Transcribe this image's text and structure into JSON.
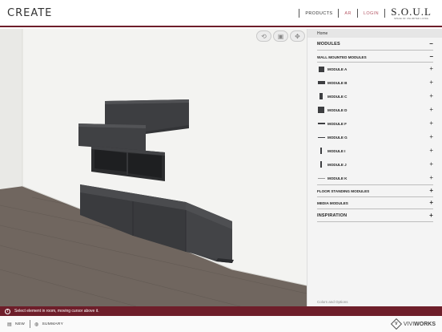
{
  "header": {
    "title": "CREATE",
    "nav": [
      {
        "label": "PRODUCTS",
        "accent": false
      },
      {
        "label": "AR",
        "accent": true
      },
      {
        "label": "LOGIN",
        "accent": true
      }
    ],
    "brand_logo": "S.O.U.L",
    "brand_tagline": "SPACE OF UNLIMITED LIVING"
  },
  "viewport": {
    "tools": [
      {
        "icon": "rotate-icon",
        "glyph": "⟲"
      },
      {
        "icon": "camera-icon",
        "glyph": "▣"
      },
      {
        "icon": "move-icon",
        "glyph": "✥"
      }
    ]
  },
  "panel": {
    "breadcrumb": "Home",
    "modules_heading": "MODULES",
    "modules_toggle": "−",
    "wall_heading": "WALL MOUNTED MODULES",
    "wall_toggle": "−",
    "modules": [
      {
        "label": "MODULE A",
        "icon": "square"
      },
      {
        "label": "MODULE B",
        "icon": "wide"
      },
      {
        "label": "MODULE C",
        "icon": "tall"
      },
      {
        "label": "MODULE D",
        "icon": "square"
      },
      {
        "label": "MODULE F",
        "icon": "flat"
      },
      {
        "label": "MODULE G",
        "icon": "thin"
      },
      {
        "label": "MODULE I",
        "icon": "vline"
      },
      {
        "label": "MODULE J",
        "icon": "vline"
      },
      {
        "label": "MODULE K",
        "icon": "hline"
      }
    ],
    "floor_heading": "FLOOR STANDING MODULES",
    "media_heading": "MEDIA MODULES",
    "inspiration_heading": "INSPIRATION",
    "plus": "+",
    "footer": "Colors and Options"
  },
  "status": {
    "icon": "!",
    "message": "Select element in room, moving cursor above it."
  },
  "footer": {
    "new_label": "NEW",
    "summary_label": "SUMMARY",
    "vendor_light": "VIVI",
    "vendor_bold": "WORKS"
  },
  "colors": {
    "accent": "#6e1e2a",
    "module": "#3d3e41",
    "floor": "#6b625c"
  }
}
